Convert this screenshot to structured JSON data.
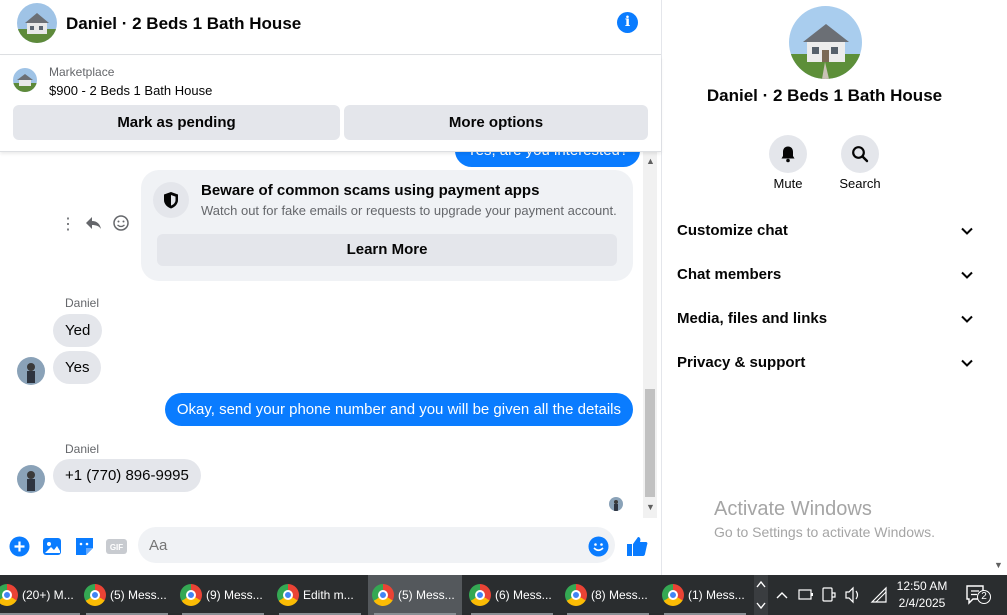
{
  "chat": {
    "title": "Daniel · 2 Beds 1 Bath House",
    "marketplace": {
      "label": "Marketplace",
      "listing": "$900 - 2 Beds 1 Bath House",
      "pending_button": "Mark as pending",
      "more_button": "More options"
    },
    "partial_message": "Yes, are you interested?",
    "warning": {
      "title": "Beware of common scams using payment apps",
      "subtitle": "Watch out for fake emails or requests to upgrade your payment account.",
      "button": "Learn More"
    },
    "messages": [
      {
        "sender": "Daniel",
        "text": "Yed"
      },
      {
        "text": "Yes"
      },
      {
        "text": "Okay, send your phone number and you will be given all the details",
        "outgoing": true
      },
      {
        "sender": "Daniel",
        "text": "+1 (770) 896-9995"
      }
    ],
    "composer_placeholder": "Aa"
  },
  "info": {
    "name": "Daniel · 2 Beds 1 Bath House",
    "actions": [
      {
        "label": "Mute",
        "icon": "bell-icon"
      },
      {
        "label": "Search",
        "icon": "search-icon"
      }
    ],
    "sections": [
      "Customize chat",
      "Chat members",
      "Media, files and links",
      "Privacy & support"
    ],
    "watermark_title": "Activate Windows",
    "watermark_sub": "Go to Settings to activate Windows."
  },
  "taskbar": {
    "items": [
      "(20+) M...",
      "(5) Mess...",
      "(9) Mess...",
      "Edith m...",
      "(5) Mess...",
      "(6) Mess...",
      "(8) Mess...",
      "(1) Mess..."
    ],
    "active_index": 4,
    "time": "12:50 AM",
    "date": "2/4/2025",
    "notifications": "2"
  },
  "colors": {
    "accent": "#0a7cff",
    "bubble_in": "#e4e6eb",
    "taskbar": "#2a2d2f"
  }
}
